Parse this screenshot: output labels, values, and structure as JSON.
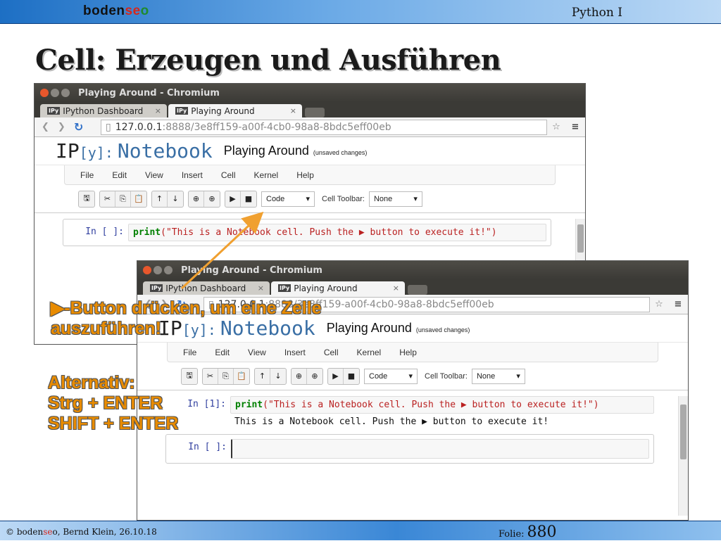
{
  "header": {
    "logo_prefix": "boden",
    "logo_se": "se",
    "logo_o": "o",
    "course": "Python I"
  },
  "slide_title": "Cell: Erzeugen und Ausführen",
  "browser": {
    "title": "Playing Around - Chromium",
    "tab1": "IPython Dashboard",
    "tab2": "Playing Around",
    "ipy_badge": "IPy",
    "tab_close": "×",
    "url_host": "127.0.0.1",
    "url_rest": ":8888/3e8ff159-a00f-4cb0-98a8-8bdc5eff00eb",
    "notebook_logo": "IP",
    "notebook_logo_y": "[y]:",
    "notebook_word": "Notebook",
    "notebook_name": "Playing Around",
    "unsaved": "(unsaved changes)",
    "menu": [
      "File",
      "Edit",
      "View",
      "Insert",
      "Cell",
      "Kernel",
      "Help"
    ],
    "cell_type": "Code",
    "cell_toolbar_label": "Cell Toolbar:",
    "cell_toolbar_value": "None",
    "code_kw": "print",
    "code_str": "(\"This is a Notebook cell. Push the ▶ button to execute it!\")",
    "output": "This is a Notebook cell. Push the ▶ button to execute it!",
    "prompt_empty": "In [ ]:",
    "prompt_run": "In [1]:"
  },
  "callout_run": "▶-Button drücken, um eine Zelle auszuführen!",
  "callout_alt": [
    "Alternativ:",
    "Strg + ENTER",
    "SHIFT + ENTER"
  ],
  "footer": {
    "copy_prefix": "© boden",
    "copy_se": "se",
    "copy_rest": "o, Bernd Klein, 26.10.18",
    "folie_label": "Folie:",
    "folie_num": "880"
  },
  "colors": {
    "callout": "#e88b00",
    "accent": "#1d6fc4",
    "arrow": "#f0a030"
  }
}
